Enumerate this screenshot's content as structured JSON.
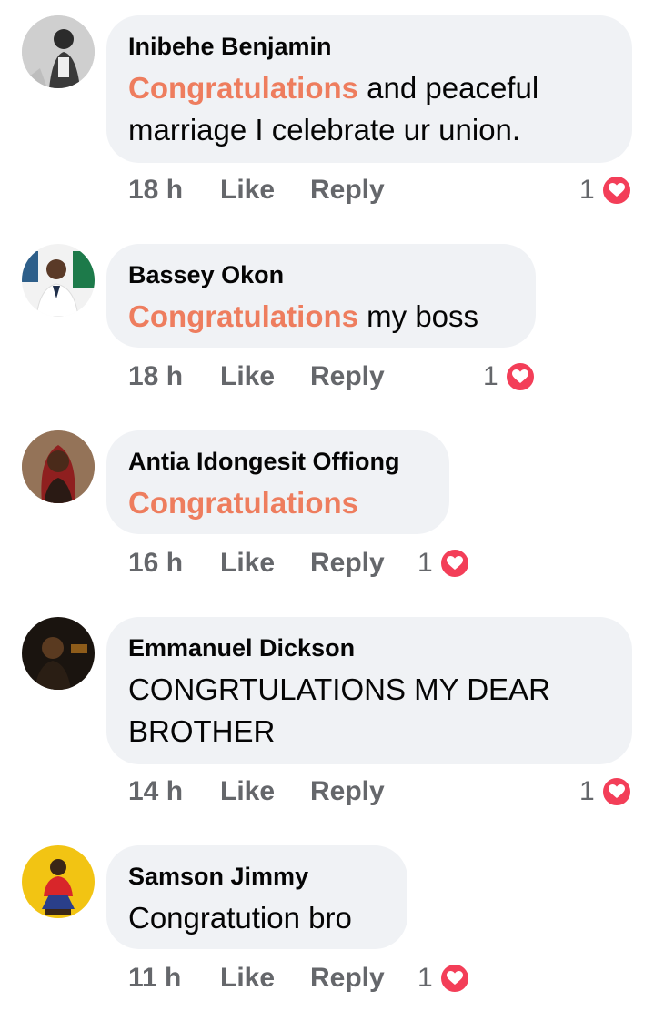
{
  "comments": [
    {
      "author": "Inibehe Benjamin",
      "highlight": "Congratulations",
      "text_after": " and peaceful marriage I celebrate ur union.",
      "time": "18 h",
      "like": "Like",
      "reply": "Reply",
      "reactions": "1",
      "reaction_icon": "heart-icon"
    },
    {
      "author": "Bassey Okon",
      "highlight": "Congratulations",
      "text_after": " my boss",
      "time": "18 h",
      "like": "Like",
      "reply": "Reply",
      "reactions": "1",
      "reaction_icon": "heart-icon"
    },
    {
      "author": "Antia Idongesit Offiong",
      "highlight": "Congratulations",
      "text_after": "",
      "time": "16 h",
      "like": "Like",
      "reply": "Reply",
      "reactions": "1",
      "reaction_icon": "heart-icon"
    },
    {
      "author": "Emmanuel Dickson",
      "highlight": "",
      "text_after": "CONGRTULATIONS MY DEAR BROTHER",
      "time": "14 h",
      "like": "Like",
      "reply": "Reply",
      "reactions": "1",
      "reaction_icon": "heart-icon"
    },
    {
      "author": "Samson Jimmy",
      "highlight": "",
      "text_after": "Congratution bro",
      "time": "11 h",
      "like": "Like",
      "reply": "Reply",
      "reactions": "1",
      "reaction_icon": "heart-icon"
    }
  ],
  "colors": {
    "bubble_bg": "#f0f2f5",
    "highlight": "#ee7d5e",
    "meta_text": "#65676b",
    "heart": "#f33e58"
  }
}
